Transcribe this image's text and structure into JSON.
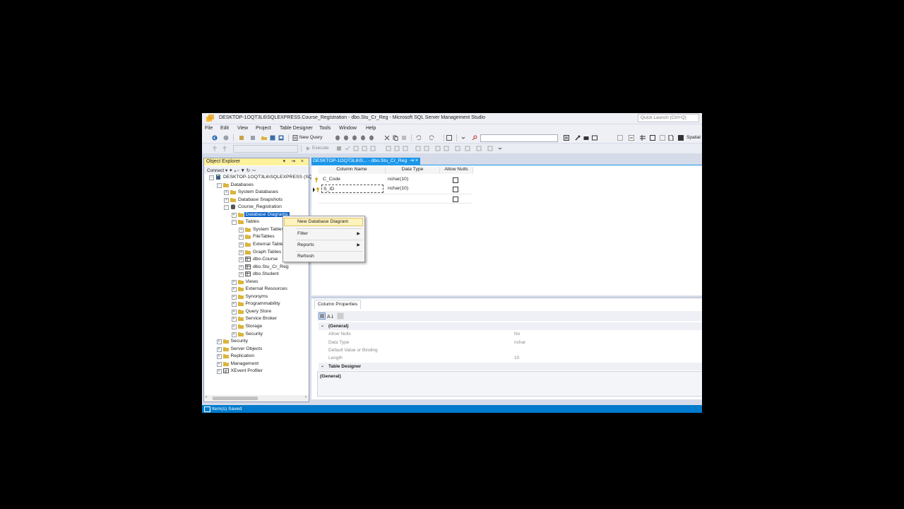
{
  "window": {
    "title": "DESKTOP-1OQT3L6\\SQLEXPRESS.Course_Registration - dbo.Stu_Cr_Reg - Microsoft SQL Server Management Studio",
    "quick_launch": "Quick Launch (Ctrl+Q)"
  },
  "menu": [
    "File",
    "Edit",
    "View",
    "Project",
    "Table Designer",
    "Tools",
    "Window",
    "Help"
  ],
  "toolbar": {
    "new_query": "New Query",
    "execute": "Execute",
    "spatial": "Spatial"
  },
  "object_explorer": {
    "title": "Object Explorer",
    "connect": "Connect",
    "tree": [
      {
        "label": "DESKTOP-1OQT3L6\\SQLEXPRESS (SQL",
        "level": 0,
        "exp": "−",
        "icon": "server"
      },
      {
        "label": "Databases",
        "level": 1,
        "exp": "−",
        "icon": "folder"
      },
      {
        "label": "System Databases",
        "level": 2,
        "exp": "+",
        "icon": "folder"
      },
      {
        "label": "Database Snapshots",
        "level": 2,
        "exp": "+",
        "icon": "folder"
      },
      {
        "label": "Course_Registration",
        "level": 2,
        "exp": "−",
        "icon": "db"
      },
      {
        "label": "Database Diagrams",
        "level": 3,
        "exp": "+",
        "icon": "folder",
        "selected": true
      },
      {
        "label": "Tables",
        "level": 3,
        "exp": "−",
        "icon": "folder"
      },
      {
        "label": "System Tables",
        "level": 4,
        "exp": "+",
        "icon": "folder"
      },
      {
        "label": "FileTables",
        "level": 4,
        "exp": "+",
        "icon": "folder"
      },
      {
        "label": "External Tables",
        "level": 4,
        "exp": "+",
        "icon": "folder"
      },
      {
        "label": "Graph Tables",
        "level": 4,
        "exp": "+",
        "icon": "folder"
      },
      {
        "label": "dbo.Course",
        "level": 4,
        "exp": "+",
        "icon": "table"
      },
      {
        "label": "dbo.Stu_Cr_Reg",
        "level": 4,
        "exp": "+",
        "icon": "table"
      },
      {
        "label": "dbo.Student",
        "level": 4,
        "exp": "+",
        "icon": "table"
      },
      {
        "label": "Views",
        "level": 3,
        "exp": "+",
        "icon": "folder"
      },
      {
        "label": "External Resources",
        "level": 3,
        "exp": "+",
        "icon": "folder"
      },
      {
        "label": "Synonyms",
        "level": 3,
        "exp": "+",
        "icon": "folder"
      },
      {
        "label": "Programmability",
        "level": 3,
        "exp": "+",
        "icon": "folder"
      },
      {
        "label": "Query Store",
        "level": 3,
        "exp": "+",
        "icon": "folder"
      },
      {
        "label": "Service Broker",
        "level": 3,
        "exp": "+",
        "icon": "folder"
      },
      {
        "label": "Storage",
        "level": 3,
        "exp": "+",
        "icon": "folder"
      },
      {
        "label": "Security",
        "level": 3,
        "exp": "+",
        "icon": "folder"
      },
      {
        "label": "Security",
        "level": 1,
        "exp": "+",
        "icon": "folder"
      },
      {
        "label": "Server Objects",
        "level": 1,
        "exp": "+",
        "icon": "folder"
      },
      {
        "label": "Replication",
        "level": 1,
        "exp": "+",
        "icon": "folder"
      },
      {
        "label": "Management",
        "level": 1,
        "exp": "+",
        "icon": "folder"
      },
      {
        "label": "XEvent Profiler",
        "level": 1,
        "exp": "+",
        "icon": "profiler"
      }
    ]
  },
  "context_menu": {
    "items": [
      {
        "label": "New Database Diagram",
        "submenu": false
      },
      {
        "label": "Filter",
        "submenu": true
      },
      {
        "label": "Reports",
        "submenu": true
      },
      {
        "label": "Refresh",
        "submenu": false
      }
    ]
  },
  "document": {
    "tab_title": "DESKTOP-1OQT3L6\\S... - dbo.Stu_Cr_Reg",
    "tab_pin": "⇥",
    "tab_close": "×",
    "columns": [
      "Column Name",
      "Data Type",
      "Allow Nulls"
    ],
    "rows": [
      {
        "name": "C_Code",
        "type": "nchar(10)",
        "allow_nulls": false,
        "key": true
      },
      {
        "name": "S_ID",
        "type": "nchar(10)",
        "allow_nulls": false,
        "key": true,
        "current": true
      }
    ]
  },
  "column_properties": {
    "tab": "Column Properties",
    "groups": [
      {
        "category": "(General)",
        "props": [
          {
            "key": "Allow Nulls",
            "value": "No"
          },
          {
            "key": "Data Type",
            "value": "nchar"
          },
          {
            "key": "Default Value or Binding",
            "value": ""
          },
          {
            "key": "Length",
            "value": "10"
          }
        ]
      },
      {
        "category": "Table Designer",
        "props": []
      }
    ],
    "description_title": "(General)"
  },
  "status": {
    "text": "Item(s) Saved"
  },
  "colors": {
    "accent": "#007acc",
    "tab_active": "#1c97ea",
    "oe_header": "#fff29d",
    "selection": "#0a63c9"
  }
}
